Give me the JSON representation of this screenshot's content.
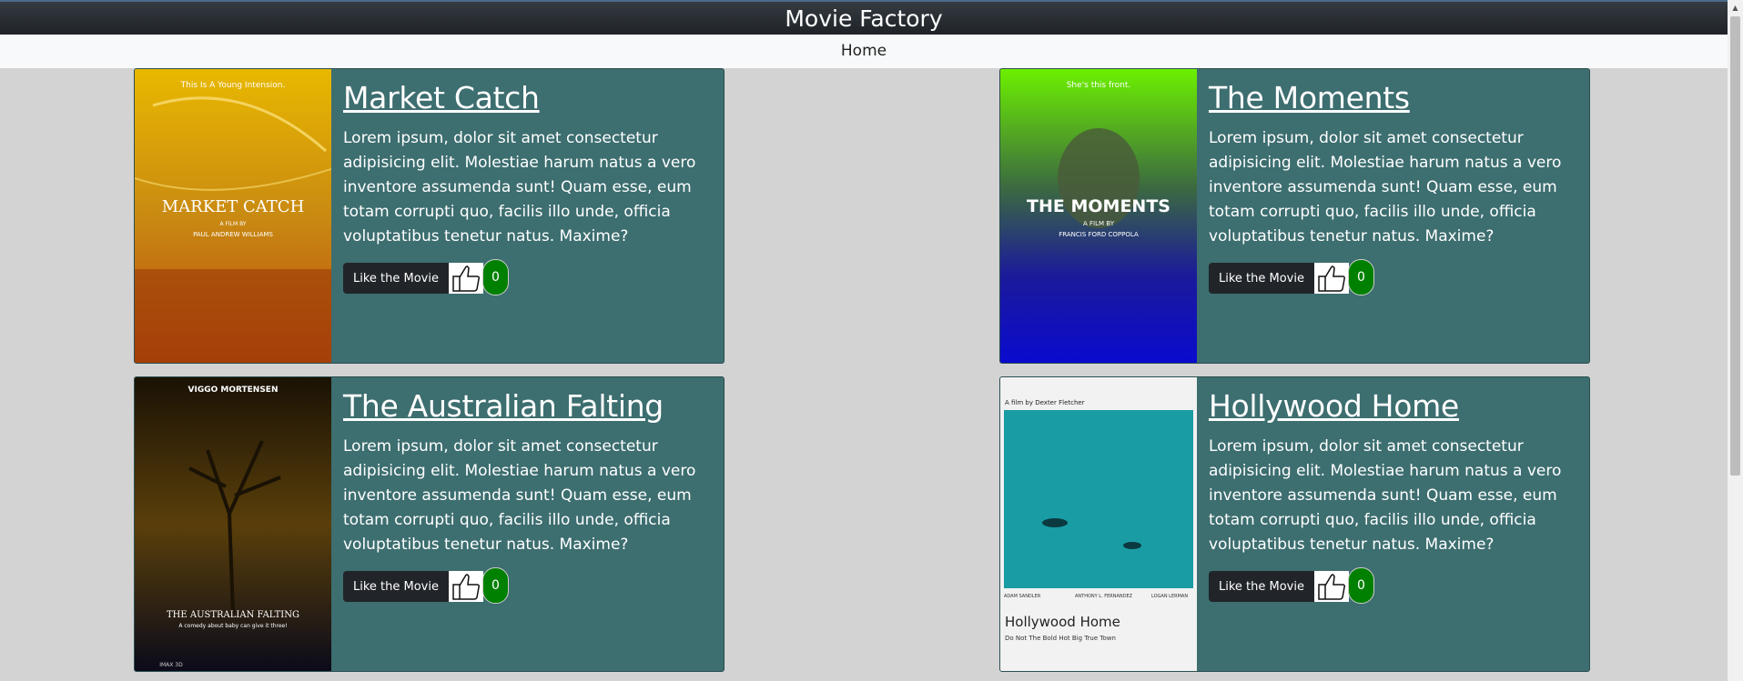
{
  "app": {
    "title": "Movie Factory"
  },
  "nav": {
    "home_label": "Home"
  },
  "movies": [
    {
      "title": "Market Catch",
      "description": "Lorem ipsum, dolor sit amet consectetur adipisicing elit. Molestiae harum natus a vero inventore assumenda sunt! Quam esse, eum totam corrupti quo, facilis illo unde, officia voluptatibus tenetur natus. Maxime?",
      "like_label": "Like the Movie",
      "likes": "0",
      "poster": {
        "tagline": "This Is A Young Intension.",
        "title": "MARKET CATCH",
        "sub1": "A FILM BY",
        "sub2": "PAUL ANDREW WILLIAMS"
      }
    },
    {
      "title": "The Moments",
      "description": "Lorem ipsum, dolor sit amet consectetur adipisicing elit. Molestiae harum natus a vero inventore assumenda sunt! Quam esse, eum totam corrupti quo, facilis illo unde, officia voluptatibus tenetur natus. Maxime?",
      "like_label": "Like the Movie",
      "likes": "0",
      "poster": {
        "tagline": "She's this front.",
        "title": "THE MOMENTS",
        "sub1": "A FILM BY",
        "sub2": "FRANCIS FORD COPPOLA"
      }
    },
    {
      "title": "The Australian Falting",
      "description": "Lorem ipsum, dolor sit amet consectetur adipisicing elit. Molestiae harum natus a vero inventore assumenda sunt! Quam esse, eum totam corrupti quo, facilis illo unde, officia voluptatibus tenetur natus. Maxime?",
      "like_label": "Like the Movie",
      "likes": "0",
      "poster": {
        "tagline": "VIGGO MORTENSEN",
        "title": "THE AUSTRALIAN FALTING",
        "sub1": "A comedy about baby can give it three!",
        "sub2": "IMAX 3D"
      }
    },
    {
      "title": "Hollywood Home",
      "description": "Lorem ipsum, dolor sit amet consectetur adipisicing elit. Molestiae harum natus a vero inventore assumenda sunt! Quam esse, eum totam corrupti quo, facilis illo unde, officia voluptatibus tenetur natus. Maxime?",
      "like_label": "Like the Movie",
      "likes": "0",
      "poster": {
        "tagline": "A film by Dexter Fletcher",
        "title": "Hollywood Home",
        "sub1": "Do Not The Bold Hot Big True Town",
        "cast": [
          "ADAM SANDLER",
          "ANTHONY L. FERNANDEZ",
          "LOGAN LERMAN"
        ]
      }
    }
  ],
  "colors": {
    "card_bg": "#3d6e70",
    "like_badge": "#008000",
    "button_bg": "#212529"
  }
}
